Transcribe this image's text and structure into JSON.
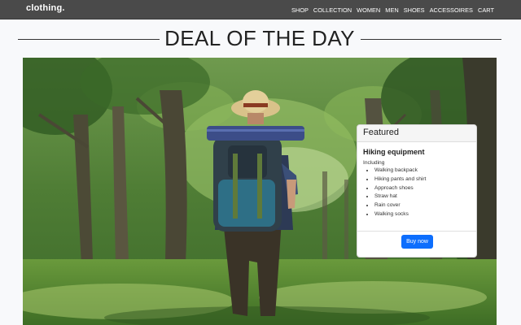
{
  "brand": "clothing.",
  "nav": [
    "SHOP",
    "COLLECTION",
    "WOMEN",
    "MEN",
    "SHOES",
    "ACCESSOIRES",
    "CART"
  ],
  "heading": "DEAL OF THE DAY",
  "hero": {
    "icon": "hiker-photo"
  },
  "card": {
    "header": "Featured",
    "title": "Hiking equipment",
    "intro": "Including",
    "items": [
      "Walking backpack",
      "Hiking pants and shirt",
      "Approach shoes",
      "Straw hat",
      "Rain cover",
      "Walking socks"
    ],
    "button": "Buy now",
    "button_color": "#0d6efd"
  }
}
